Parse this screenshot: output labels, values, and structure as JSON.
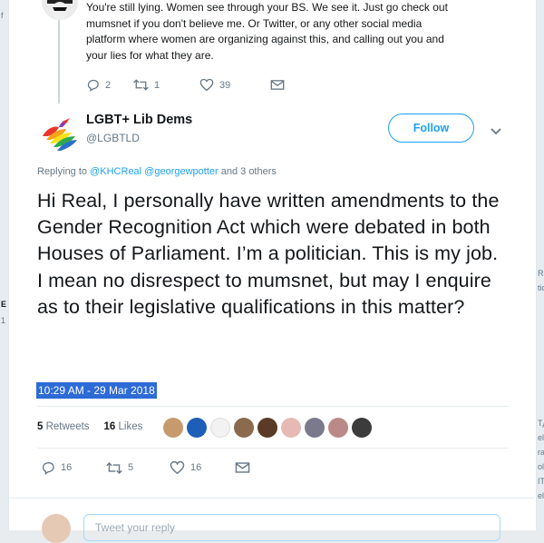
{
  "backdrop": {
    "right_fragments": [
      "Re",
      "tic",
      "Tд",
      "ell",
      "ra",
      "oll",
      "IT",
      "elt"
    ],
    "left_fragments": [
      "f",
      "E",
      "1"
    ]
  },
  "previous_tweet": {
    "text": "You're still lying. Women see through your BS. We see it. Just go check out mumsnet if you don't believe me. Or Twitter, or any other social media platform where women are organizing against this, and calling out you and your lies for what they are.",
    "reply_count": "2",
    "retweet_count": "1",
    "like_count": "39"
  },
  "main_tweet": {
    "display_name": "LGBT+ Lib Dems",
    "handle": "@LGBTLD",
    "follow_label": "Follow",
    "replying_prefix": "Replying to",
    "replying_links": "@KHCReal @georgewpotter",
    "replying_suffix": "and 3 others",
    "text": "Hi Real, I personally have written amendments to the Gender Recognition Act which were debated in both Houses of Parliament. I’m a politician. This is my job. I mean no disrespect to mumsnet, but may I enquire as to their legislative qualifications in this matter?",
    "timestamp": "10:29 AM - 29 Mar 2018",
    "retweets_count": "5",
    "retweets_label": "Retweets",
    "likes_count": "16",
    "likes_label": "Likes",
    "reply_count": "16",
    "retweet_count": "5",
    "like_count": "16"
  },
  "reply_box": {
    "placeholder": "Tweet your reply"
  },
  "colors": {
    "accent": "#1da1f2",
    "muted": "#657786",
    "selection": "#2d6bd6"
  },
  "icons": [
    "reply-icon",
    "retweet-icon",
    "heart-icon",
    "mail-icon",
    "chevron-down-icon"
  ]
}
